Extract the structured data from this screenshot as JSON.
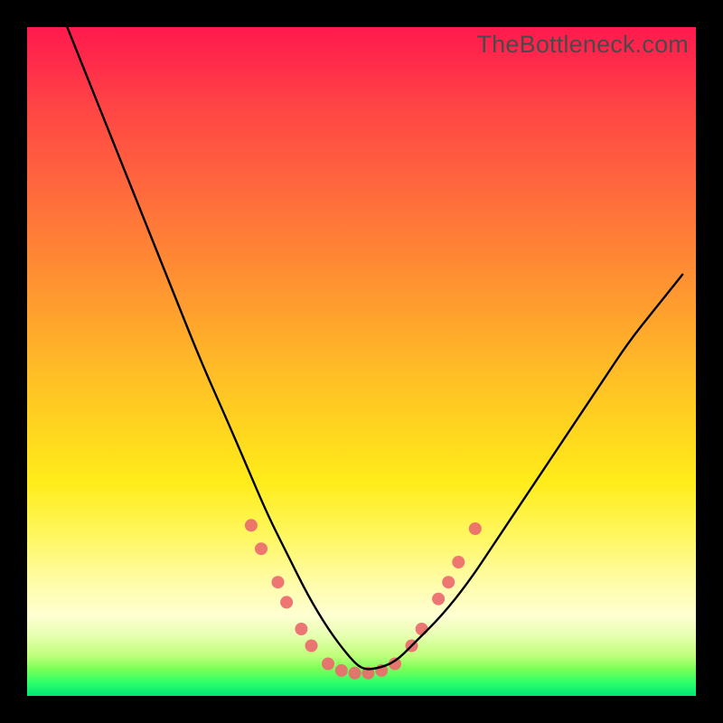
{
  "watermark": "TheBottleneck.com",
  "chart_data": {
    "type": "line",
    "title": "",
    "xlabel": "",
    "ylabel": "",
    "xlim": [
      0,
      100
    ],
    "ylim": [
      0,
      100
    ],
    "grid": false,
    "legend": false,
    "note": "Bottleneck percentage curve. No axes or ticks shown in image; values are estimated relative positions (0–100). Curve is black; scattered pink dots cluster near the trough.",
    "series": [
      {
        "name": "bottleneck-curve",
        "color": "#000000",
        "x": [
          6,
          10,
          14,
          18,
          22,
          26,
          30,
          33,
          36,
          39,
          42,
          45,
          48,
          50,
          52,
          55,
          58,
          62,
          66,
          70,
          74,
          78,
          82,
          86,
          90,
          94,
          98
        ],
        "y": [
          100,
          90,
          80,
          70,
          60,
          50,
          41,
          34,
          27,
          21,
          15,
          10,
          6,
          4,
          4,
          5,
          8,
          12,
          17,
          23,
          29,
          35,
          41,
          47,
          53,
          58,
          63
        ]
      }
    ],
    "dots": {
      "name": "data-points",
      "color": "#ec6a6e",
      "radius": 7,
      "points": [
        {
          "x": 33.5,
          "y": 25.5
        },
        {
          "x": 35.0,
          "y": 22.0
        },
        {
          "x": 37.5,
          "y": 17.0
        },
        {
          "x": 38.8,
          "y": 14.0
        },
        {
          "x": 41.0,
          "y": 10.0
        },
        {
          "x": 42.5,
          "y": 7.5
        },
        {
          "x": 45.0,
          "y": 4.8
        },
        {
          "x": 47.0,
          "y": 3.8
        },
        {
          "x": 49.0,
          "y": 3.4
        },
        {
          "x": 51.0,
          "y": 3.4
        },
        {
          "x": 53.0,
          "y": 3.8
        },
        {
          "x": 55.0,
          "y": 4.8
        },
        {
          "x": 57.5,
          "y": 7.5
        },
        {
          "x": 59.0,
          "y": 10.0
        },
        {
          "x": 61.5,
          "y": 14.5
        },
        {
          "x": 63.0,
          "y": 17.0
        },
        {
          "x": 64.5,
          "y": 20.0
        },
        {
          "x": 67.0,
          "y": 25.0
        }
      ]
    }
  }
}
